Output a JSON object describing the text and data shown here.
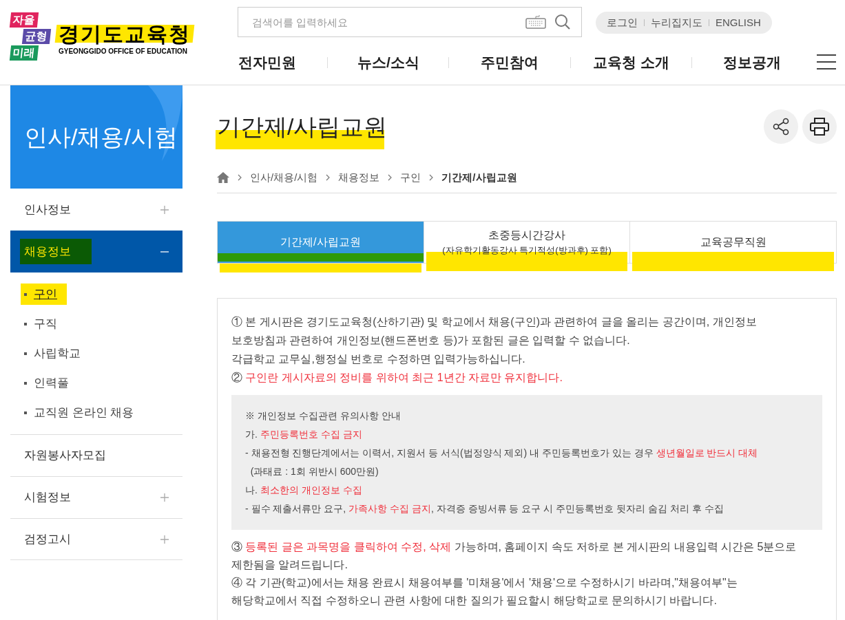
{
  "logo": {
    "badges": [
      "자율",
      "균형",
      "미래"
    ],
    "name": "경기도교육청",
    "subtitle": "GYEONGGIDO OFFICE OF EDUCATION"
  },
  "search": {
    "placeholder": "검색어를 입력하세요"
  },
  "utility_links": [
    "로그인",
    "누리집지도",
    "ENGLISH"
  ],
  "nav": [
    "전자민원",
    "뉴스/소식",
    "주민참여",
    "교육청 소개",
    "정보공개"
  ],
  "sidebar": {
    "title": "인사/채용/시험",
    "items": [
      {
        "label": "인사정보",
        "kind": "expandable",
        "expanded": false,
        "selected": false,
        "highlighted": false
      },
      {
        "label": "채용정보",
        "kind": "expandable",
        "expanded": true,
        "selected": true,
        "highlighted": true,
        "children": [
          {
            "label": "구인",
            "selected": true,
            "highlighted": true
          },
          {
            "label": "구직",
            "selected": false,
            "highlighted": false
          },
          {
            "label": "사립학교",
            "selected": false,
            "highlighted": false
          },
          {
            "label": "인력풀",
            "selected": false,
            "highlighted": false
          },
          {
            "label": "교직원 온라인 채용",
            "selected": false,
            "highlighted": false
          }
        ]
      },
      {
        "label": "자원봉사자모집",
        "kind": "link",
        "selected": false,
        "highlighted": false
      },
      {
        "label": "시험정보",
        "kind": "expandable",
        "expanded": false,
        "selected": false,
        "highlighted": false
      },
      {
        "label": "검정고시",
        "kind": "expandable",
        "expanded": false,
        "selected": false,
        "highlighted": false
      }
    ]
  },
  "page_title": {
    "text": "기간제/사립교원",
    "highlighted": true
  },
  "breadcrumb": [
    "인사/채용/시험",
    "채용정보",
    "구인",
    "기간제/사립교원"
  ],
  "tabs": [
    {
      "label": "기간제/사립교원",
      "selected": true,
      "highlighted": true
    },
    {
      "label": "초중등시간강사",
      "sublabel": "(자유학기활동강사 특기적성(방과후) 포함)",
      "selected": false,
      "highlighted": true
    },
    {
      "label": "교육공무직원",
      "selected": false,
      "highlighted": true
    }
  ],
  "notice": {
    "lines_top": [
      [
        {
          "text": "① 본 게시판은 경기도교육청(산하기관) 및 학교에서 채용(구인)과 관련하여 글을 올리는 공간이며, 개인정보",
          "red": false
        }
      ],
      [
        {
          "text": "보호방침과 관련하여 개인정보(핸드폰번호 등)가 포함된 글은 입력할 수 없습니다.",
          "red": false
        }
      ],
      [
        {
          "text": "각급학교 교무실,행정실 번호로 수정하면 입력가능하십니다.",
          "red": false
        }
      ],
      [
        {
          "text": "② ",
          "red": false
        },
        {
          "text": "구인란 게시자료의 정비를 위하여 최근 1년간 자료만 유지합니다.",
          "red": true
        }
      ]
    ],
    "privacy_box": [
      [
        {
          "text": "※ 개인정보 수집관련 유의사항 안내",
          "red": false
        }
      ],
      [
        {
          "text": "가. ",
          "red": false
        },
        {
          "text": "주민등록번호 수집 금지",
          "red": true
        }
      ],
      [
        {
          "text": "- 채용전형 진행단계에서는 이력서, 지원서 등 서식(법정양식 제외) 내 주민등록번호가 있는 경우 ",
          "red": false
        },
        {
          "text": "생년월일로 반드시 대체",
          "red": true
        }
      ],
      [
        {
          "text": "  (과태료 : 1회 위반시 600만원)",
          "red": false
        }
      ],
      [
        {
          "text": "나. ",
          "red": false
        },
        {
          "text": "최소한의 개인정보 수집",
          "red": true
        }
      ],
      [
        {
          "text": "- 필수 제출서류만 요구, ",
          "red": false
        },
        {
          "text": "가족사항 수집 금지",
          "red": true
        },
        {
          "text": ", 자격증 증빙서류 등 요구 시 주민등록번호 뒷자리 숨김 처리 후 수집",
          "red": false
        }
      ]
    ],
    "lines_bottom": [
      [
        {
          "text": "③ ",
          "red": false
        },
        {
          "text": "등록된 글은 과목명을 클릭하여 수정, 삭제",
          "red": true
        },
        {
          "text": " 가능하며, 홈페이지 속도 저하로 본 게시판의 내용입력 시간은 5분으로",
          "red": false
        }
      ],
      [
        {
          "text": "제한됨을 알려드립니다.",
          "red": false
        }
      ],
      [
        {
          "text": "④ 각 기관(학교)에서는 채용 완료시 채용여부를 '미채용'에서 '채용'으로 수정하시기 바라며,\"채용여부\"는",
          "red": false
        }
      ],
      [
        {
          "text": "해당학교에서 직접 수정하오니 관련 사항에 대한 질의가 필요할시 해당학교로 문의하시기 바랍니다.",
          "red": false
        }
      ]
    ]
  }
}
